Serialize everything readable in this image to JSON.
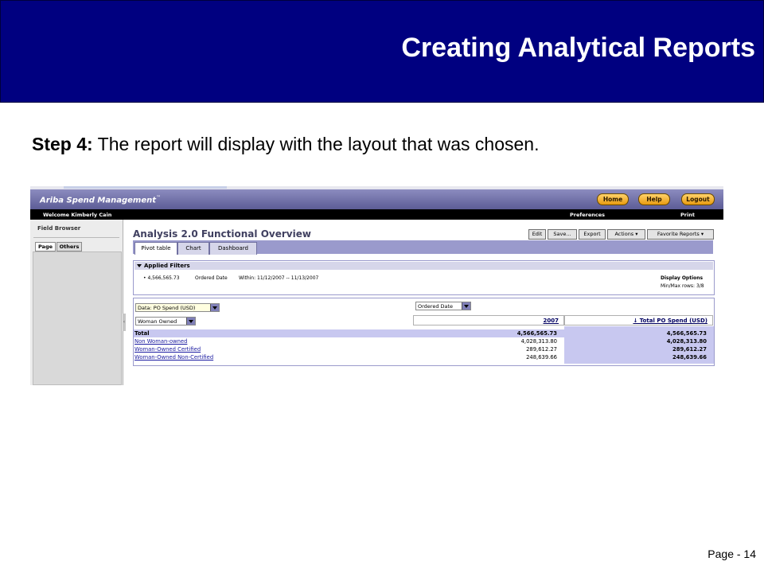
{
  "slide": {
    "title": "Creating Analytical Reports",
    "step_label": "Step 4:",
    "step_text": " The report will display with the layout that was chosen.",
    "page": "Page - 14"
  },
  "app": {
    "brand": "Ariba  Spend Management",
    "brand_tm": "™",
    "nav": {
      "home": "Home",
      "help": "Help",
      "logout": "Logout"
    },
    "welcome": "Welcome Kimberly Cain",
    "preferences": "Preferences",
    "print": "Print"
  },
  "left_panel": {
    "title": "Field Browser",
    "tabs": [
      "Page",
      "Others"
    ]
  },
  "report": {
    "title": "Analysis 2.0 Functional Overview",
    "toolbar": {
      "edit": "Edit",
      "save": "Save...",
      "export": "Export",
      "actions": "Actions ▾",
      "favorites": "Favorite Reports ▾"
    },
    "tabs": [
      "Pivot table",
      "Chart",
      "Dashboard"
    ]
  },
  "filters": {
    "header": "Applied Filters",
    "value": "• 4,566,565.73",
    "field": "Ordered Date",
    "range": "Within: 11/12/2007 -- 11/13/2007",
    "display_options": "Display Options",
    "minmax": "Min/Max rows: 3/8"
  },
  "pivot": {
    "data_select": "Data: PO Spend (USD)",
    "column_select": "Ordered Date",
    "row_select": "Woman Owned",
    "col_year": "2007",
    "col_total": "↓ Total PO Spend (USD)",
    "rows": [
      {
        "label": "Total",
        "v2007": "4,566,565.73",
        "total": "4,566,565.73"
      },
      {
        "label": "Non Woman-owned",
        "v2007": "4,028,313.80",
        "total": "4,028,313.80"
      },
      {
        "label": "Woman-Owned Certified",
        "v2007": "289,612.27",
        "total": "289,612.27"
      },
      {
        "label": "Woman-Owned Non-Certified",
        "v2007": "248,639.66",
        "total": "248,639.66"
      }
    ]
  },
  "colors": {
    "slide_header": "#000080",
    "app_banner": "#6b6ba3",
    "accent_lavender": "#c8c8f0",
    "nav_button": "#f5b234"
  }
}
